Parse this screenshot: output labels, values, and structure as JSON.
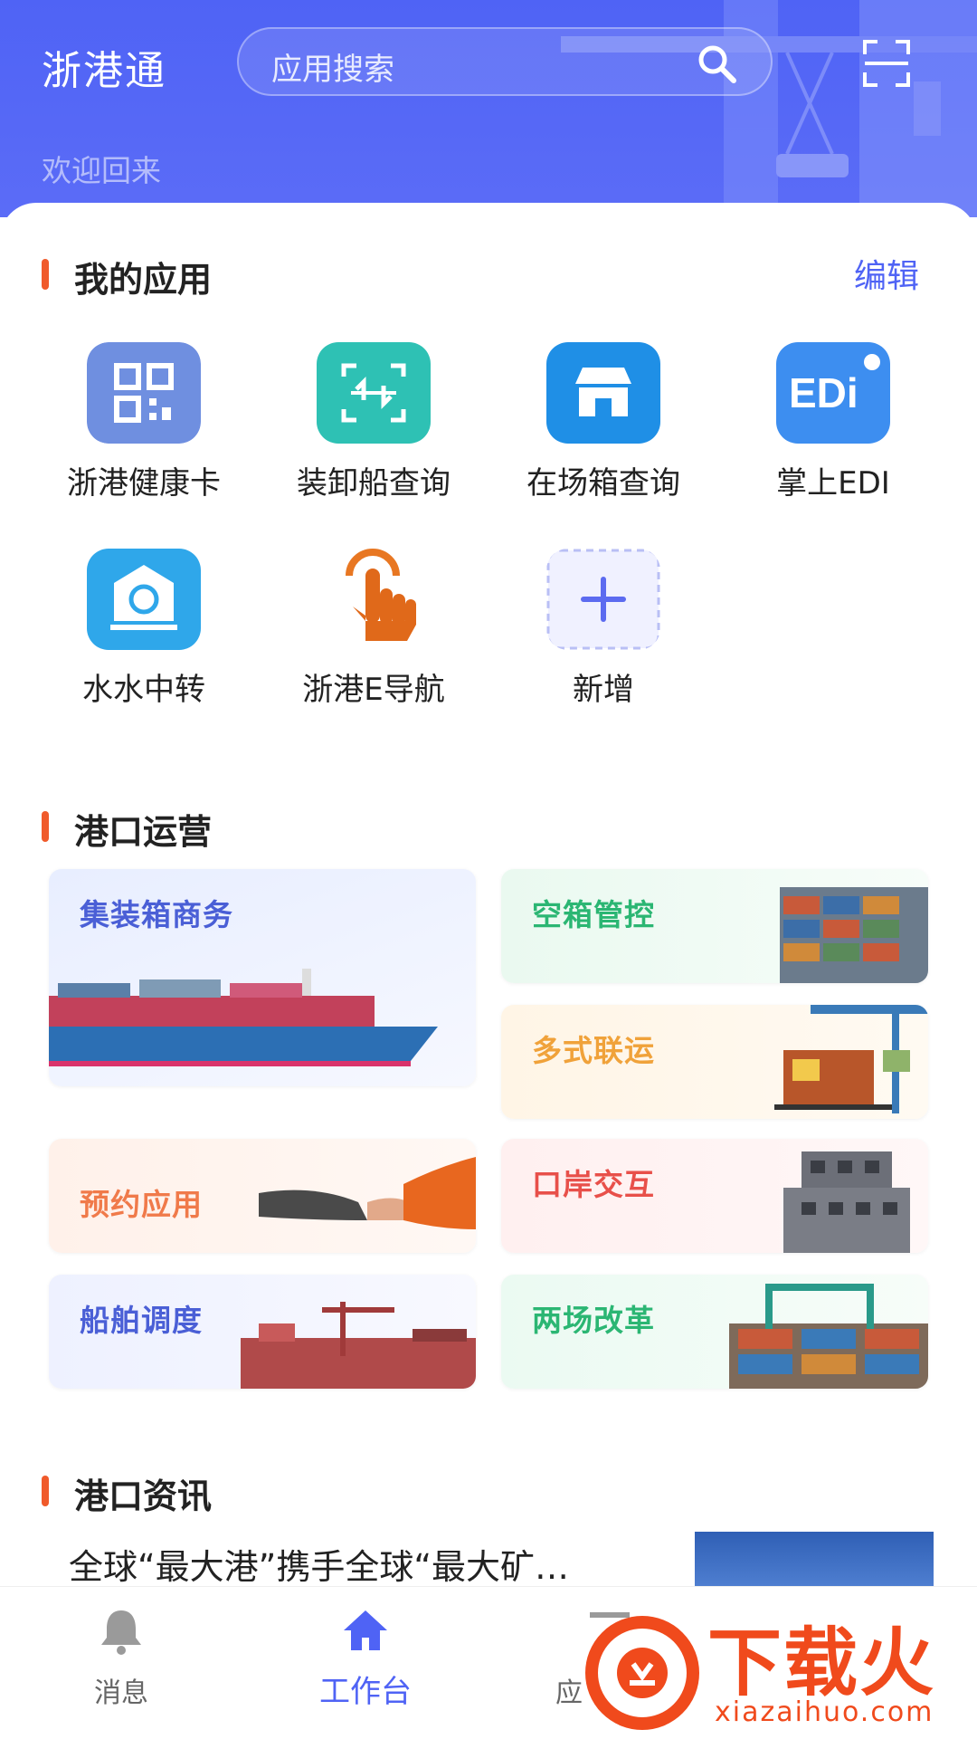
{
  "header": {
    "title": "浙港通",
    "search_placeholder": "应用搜索",
    "welcome": "欢迎回来"
  },
  "my_apps": {
    "title": "我的应用",
    "edit": "编辑",
    "items": [
      {
        "label": "浙港健康卡",
        "icon": "qr-code-icon"
      },
      {
        "label": "装卸船查询",
        "icon": "ship-transfer-icon"
      },
      {
        "label": "在场箱查询",
        "icon": "store-icon"
      },
      {
        "label": "掌上EDI",
        "icon": "edi-icon"
      },
      {
        "label": "水水中转",
        "icon": "transfer-cycle-icon"
      },
      {
        "label": "浙港E导航",
        "icon": "tap-hand-icon"
      },
      {
        "label": "新增",
        "icon": "add-icon"
      }
    ]
  },
  "port_ops": {
    "title": "港口运营",
    "cards": [
      {
        "label": "集装箱商务",
        "color": "#4a5fd6"
      },
      {
        "label": "空箱管控",
        "color": "#2bb673"
      },
      {
        "label": "多式联运",
        "color": "#f0a23a"
      },
      {
        "label": "预约应用",
        "color": "#f07a4a"
      },
      {
        "label": "口岸交互",
        "color": "#e8504a"
      },
      {
        "label": "船舶调度",
        "color": "#4a5fd6"
      },
      {
        "label": "两场改革",
        "color": "#2bb673"
      }
    ]
  },
  "news": {
    "title": "港口资讯",
    "headline": "全球“最大港”携手全球“最大矿…"
  },
  "tabbar": {
    "items": [
      {
        "label": "消息",
        "icon": "bell-icon"
      },
      {
        "label": "工作台",
        "icon": "home-icon"
      },
      {
        "label": "应",
        "icon": "apps-icon"
      }
    ]
  },
  "watermark": {
    "text": "下载火",
    "sub": "xiazaihuo.com"
  }
}
